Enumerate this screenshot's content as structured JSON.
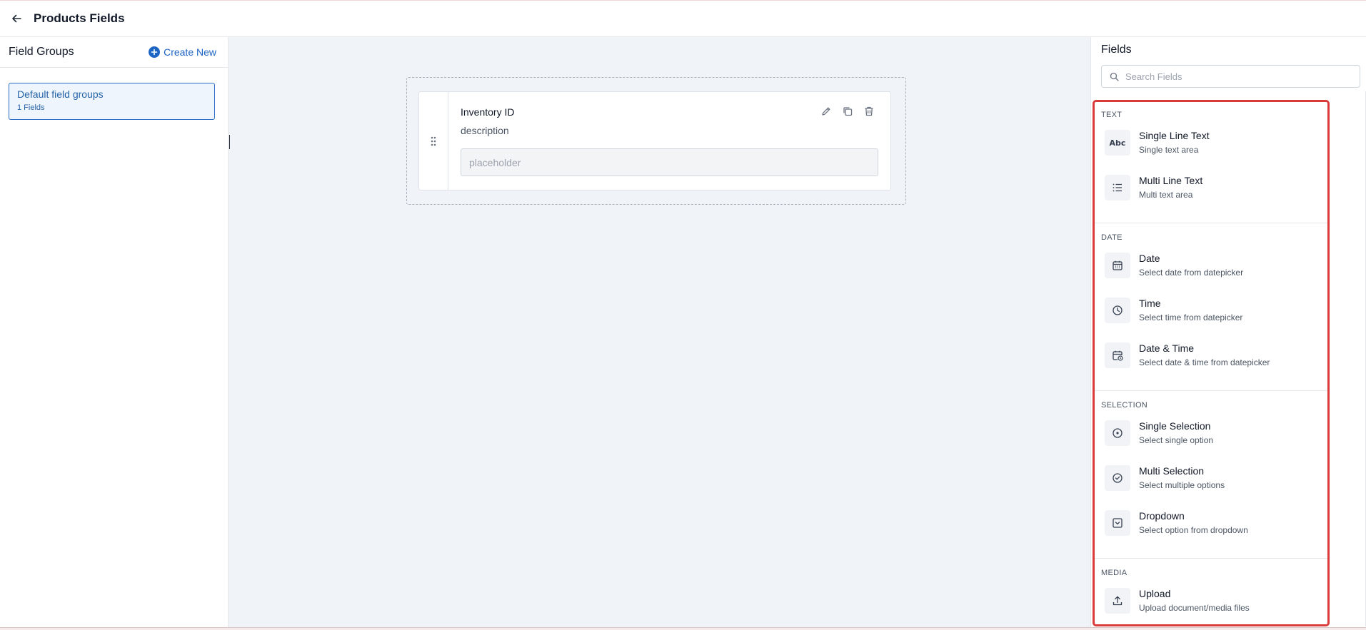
{
  "header": {
    "title": "Products Fields"
  },
  "left_panel": {
    "title": "Field Groups",
    "create_label": "Create New",
    "groups": [
      {
        "name": "Default field groups",
        "count": "1 Fields"
      }
    ]
  },
  "canvas": {
    "field": {
      "label": "Inventory ID",
      "description": "description",
      "placeholder": "placeholder"
    }
  },
  "right_panel": {
    "title": "Fields",
    "search_placeholder": "Search Fields",
    "sections": [
      {
        "label": "TEXT",
        "items": [
          {
            "title": "Single Line Text",
            "desc": "Single text area",
            "icon": "abc-icon"
          },
          {
            "title": "Multi Line Text",
            "desc": "Multi text area",
            "icon": "list-icon"
          }
        ]
      },
      {
        "label": "DATE",
        "items": [
          {
            "title": "Date",
            "desc": "Select date from datepicker",
            "icon": "calendar-icon"
          },
          {
            "title": "Time",
            "desc": "Select time from datepicker",
            "icon": "clock-icon"
          },
          {
            "title": "Date & Time",
            "desc": "Select date & time from datepicker",
            "icon": "calendar-clock-icon"
          }
        ]
      },
      {
        "label": "SELECTION",
        "items": [
          {
            "title": "Single Selection",
            "desc": "Select single option",
            "icon": "radio-icon"
          },
          {
            "title": "Multi Selection",
            "desc": "Select multiple options",
            "icon": "check-circle-icon"
          },
          {
            "title": "Dropdown",
            "desc": "Select option from dropdown",
            "icon": "dropdown-icon"
          }
        ]
      },
      {
        "label": "MEDIA",
        "items": [
          {
            "title": "Upload",
            "desc": "Upload document/media files",
            "icon": "upload-icon"
          }
        ]
      }
    ]
  },
  "colors": {
    "accent": "#1d64c4",
    "highlight_border": "#d93a3a",
    "canvas_bg": "#f0f3f7"
  }
}
